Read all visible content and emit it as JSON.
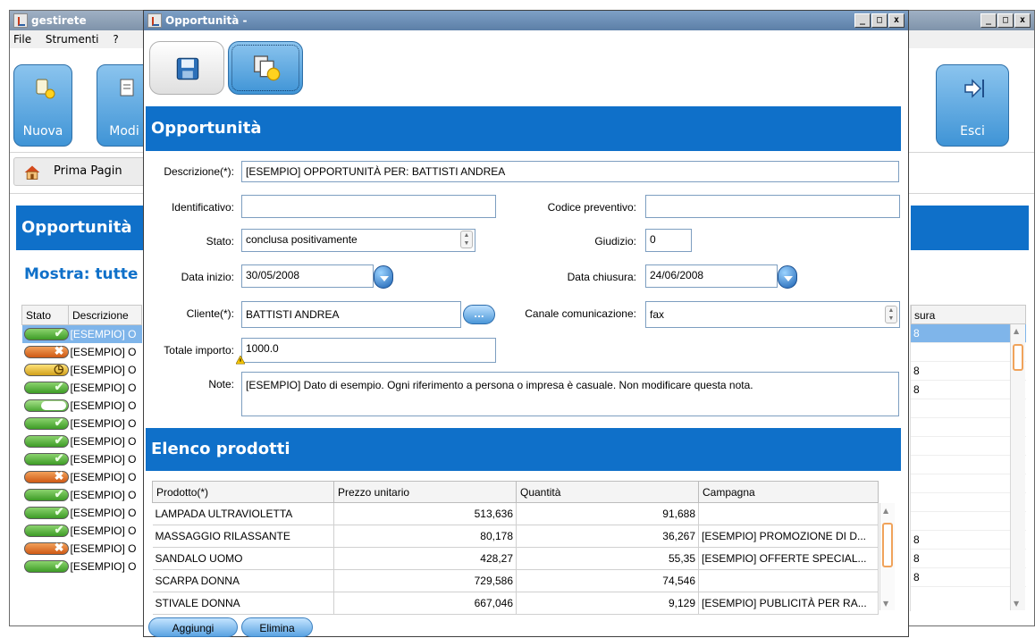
{
  "background_window": {
    "title": "gestirete",
    "menu": [
      "File",
      "Strumenti",
      "?"
    ],
    "buttons": {
      "nuova": "Nuova",
      "modifica": "Modi",
      "esci": "Esci"
    },
    "home_tab": "Prima Pagin",
    "section_title": "Opportunità",
    "filter_label": "Mostra:",
    "filter_value": "tutte",
    "table": {
      "headers": {
        "stato": "Stato",
        "descrizione": "Descrizione",
        "chiusura": "sura"
      },
      "rows": [
        {
          "status": "ok",
          "desc": "[ESEMPIO] O",
          "chiusura": "8"
        },
        {
          "status": "ko",
          "desc": "[ESEMPIO] O",
          "chiusura": ""
        },
        {
          "status": "wait",
          "desc": "[ESEMPIO] O",
          "chiusura": "8"
        },
        {
          "status": "ok",
          "desc": "[ESEMPIO] O",
          "chiusura": "8"
        },
        {
          "status": "empty",
          "desc": "[ESEMPIO] O",
          "chiusura": ""
        },
        {
          "status": "ok",
          "desc": "[ESEMPIO] O",
          "chiusura": ""
        },
        {
          "status": "ok",
          "desc": "[ESEMPIO] O",
          "chiusura": ""
        },
        {
          "status": "ok",
          "desc": "[ESEMPIO] O",
          "chiusura": ""
        },
        {
          "status": "ko",
          "desc": "[ESEMPIO] O",
          "chiusura": ""
        },
        {
          "status": "ok",
          "desc": "[ESEMPIO] O",
          "chiusura": ""
        },
        {
          "status": "ok",
          "desc": "[ESEMPIO] O",
          "chiusura": ""
        },
        {
          "status": "ok",
          "desc": "[ESEMPIO] O",
          "chiusura": "8"
        },
        {
          "status": "ko",
          "desc": "[ESEMPIO] O",
          "chiusura": "8"
        },
        {
          "status": "ok",
          "desc": "[ESEMPIO] O",
          "chiusura": "8"
        }
      ]
    }
  },
  "dialog": {
    "title": "Opportunità -",
    "section_title": "Opportunità",
    "labels": {
      "descrizione": "Descrizione(*):",
      "identificativo": "Identificativo:",
      "codice_preventivo": "Codice preventivo:",
      "stato": "Stato:",
      "giudizio": "Giudizio:",
      "data_inizio": "Data inizio:",
      "data_chiusura": "Data chiusura:",
      "cliente": "Cliente(*):",
      "canale": "Canale comunicazione:",
      "totale": "Totale importo:",
      "note": "Note:"
    },
    "values": {
      "descrizione": "[ESEMPIO] OPPORTUNITÀ PER: BATTISTI ANDREA",
      "identificativo": "",
      "codice_preventivo": "",
      "stato": "conclusa positivamente",
      "giudizio": "0",
      "data_inizio": "30/05/2008",
      "data_chiusura": "24/06/2008",
      "cliente": "BATTISTI ANDREA",
      "cliente_button": "...",
      "canale": "fax",
      "totale": "1000.0",
      "note": "[ESEMPIO] Dato di esempio. Ogni riferimento a persona o impresa è casuale. Non modificare questa nota."
    },
    "products_title": "Elenco prodotti",
    "products": {
      "headers": {
        "prodotto": "Prodotto(*)",
        "prezzo": "Prezzo unitario",
        "quantita": "Quantità",
        "campagna": "Campagna"
      },
      "rows": [
        {
          "prodotto": "LAMPADA ULTRAVIOLETTA",
          "prezzo": "513,636",
          "quantita": "91,688",
          "campagna": ""
        },
        {
          "prodotto": "MASSAGGIO RILASSANTE",
          "prezzo": "80,178",
          "quantita": "36,267",
          "campagna": "[ESEMPIO] PROMOZIONE DI D..."
        },
        {
          "prodotto": "SANDALO UOMO",
          "prezzo": "428,27",
          "quantita": "55,35",
          "campagna": "[ESEMPIO] OFFERTE SPECIAL..."
        },
        {
          "prodotto": "SCARPA DONNA",
          "prezzo": "729,586",
          "quantita": "74,546",
          "campagna": ""
        },
        {
          "prodotto": "STIVALE DONNA",
          "prezzo": "667,046",
          "quantita": "9,129",
          "campagna": "[ESEMPIO] PUBLICITÀ PER RA..."
        }
      ]
    },
    "buttons": {
      "aggiungi": "Aggiungi",
      "elimina": "Elimina"
    }
  },
  "colors": {
    "accent": "#0f70c9",
    "selection": "#7fb5ea",
    "scroll_thumb": "#f0a35b"
  }
}
